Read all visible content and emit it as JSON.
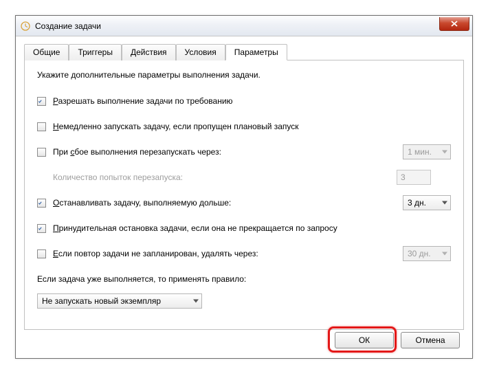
{
  "window": {
    "title": "Создание задачи"
  },
  "tabs": {
    "items": [
      {
        "label": "Общие"
      },
      {
        "label": "Триггеры"
      },
      {
        "label": "Действия"
      },
      {
        "label": "Условия"
      },
      {
        "label": "Параметры"
      }
    ],
    "active_index": 4
  },
  "panel": {
    "description": "Укажите дополнительные параметры выполнения задачи.",
    "allow_demand": {
      "checked": true,
      "prefix": "Р",
      "text": "азрешать выполнение задачи по требованию"
    },
    "run_if_missed": {
      "checked": false,
      "prefix": "Н",
      "text": "емедленно запускать задачу, если пропущен плановый запуск"
    },
    "restart_on_fail": {
      "checked": false,
      "prefix": "с",
      "pretext": "При ",
      "text": "бое выполнения перезапускать через:",
      "interval": "1 мин."
    },
    "retry_count": {
      "label": "Количество попыток перезапуска:",
      "value": "3"
    },
    "stop_if_longer": {
      "checked": true,
      "prefix": "О",
      "text": "станавливать задачу, выполняемую дольше:",
      "value": "3 дн."
    },
    "force_stop": {
      "checked": true,
      "prefix": "П",
      "text": "ринудительная остановка задачи, если она не прекращается по запросу"
    },
    "delete_if_not_scheduled": {
      "checked": false,
      "prefix": "Е",
      "text": "сли повтор задачи не запланирован, удалять через:",
      "value": "30 дн."
    },
    "already_running_label": "Если задача уже выполняется, то применять правило:",
    "already_running_value": "Не запускать новый экземпляр"
  },
  "buttons": {
    "ok": "ОК",
    "cancel": "Отмена"
  }
}
